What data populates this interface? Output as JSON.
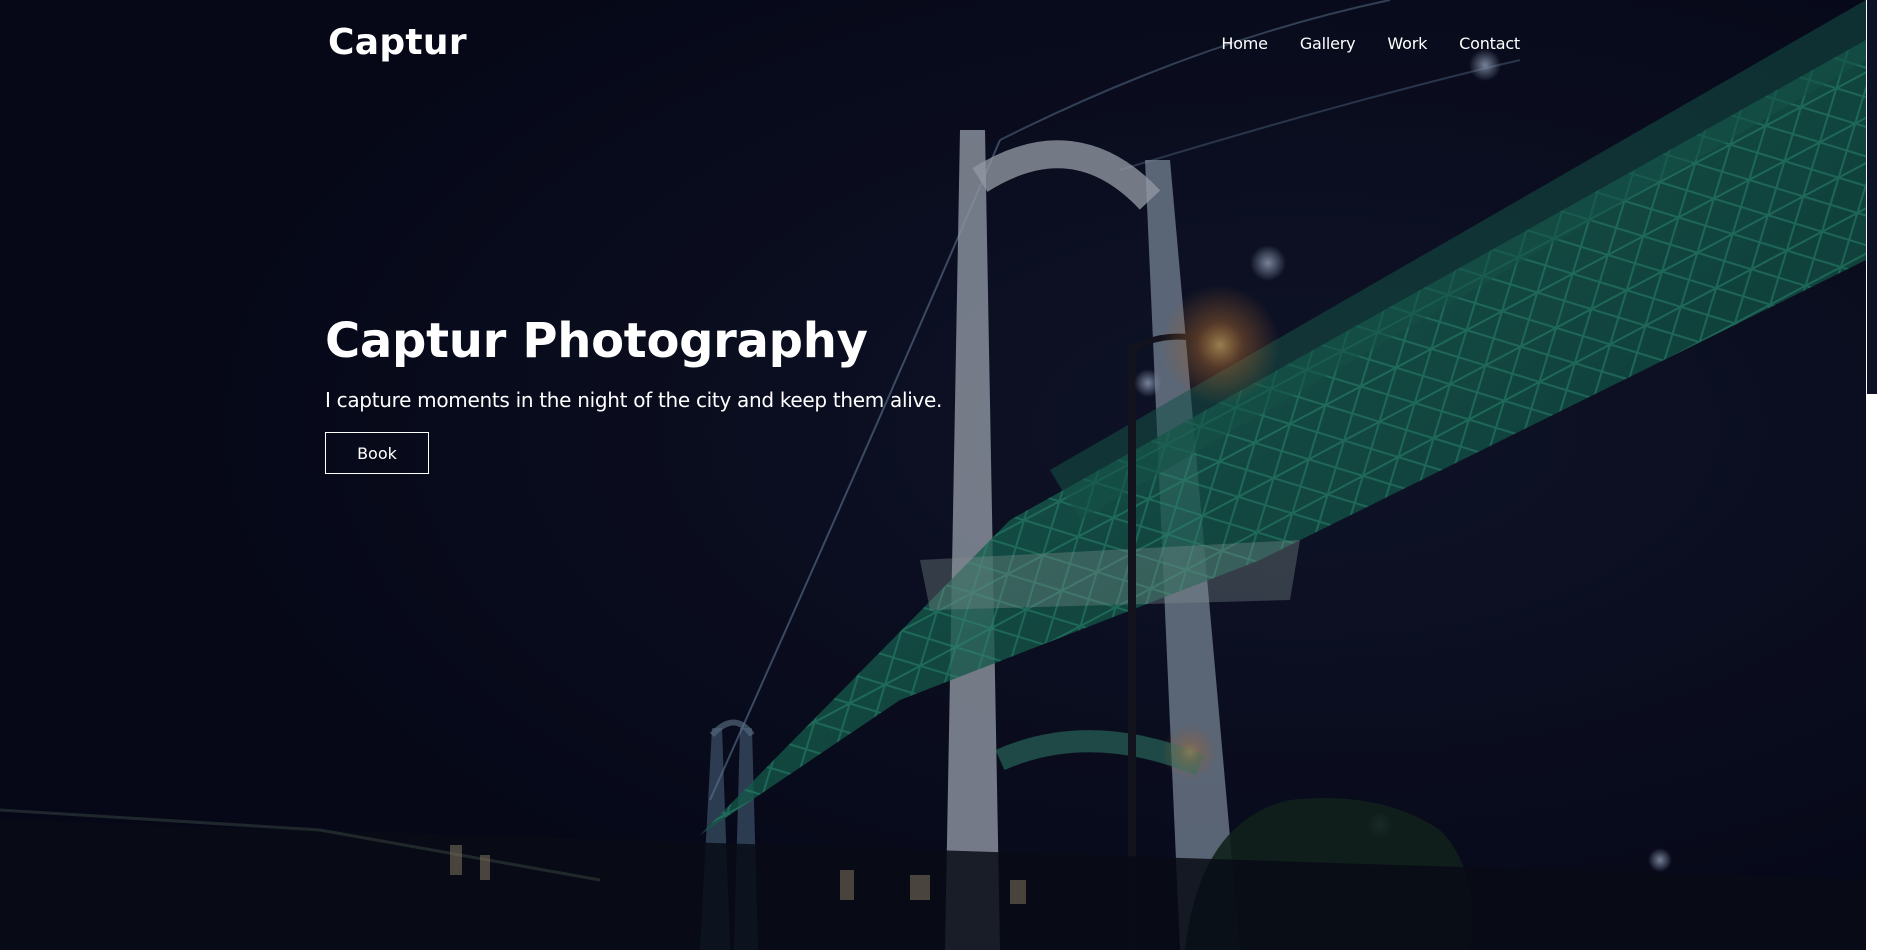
{
  "brand": {
    "name": "Captur"
  },
  "nav": {
    "items": [
      {
        "label": "Home"
      },
      {
        "label": "Gallery"
      },
      {
        "label": "Work"
      },
      {
        "label": "Contact"
      }
    ]
  },
  "hero": {
    "title": "Captur Photography",
    "subtitle": "I capture moments in the night of the city and keep them alive.",
    "button_label": "Book"
  },
  "colors": {
    "overlay": "#0a0d1c",
    "text": "#ffffff",
    "bridge_glow": "#1fa37a",
    "lamp": "#ffb347"
  }
}
